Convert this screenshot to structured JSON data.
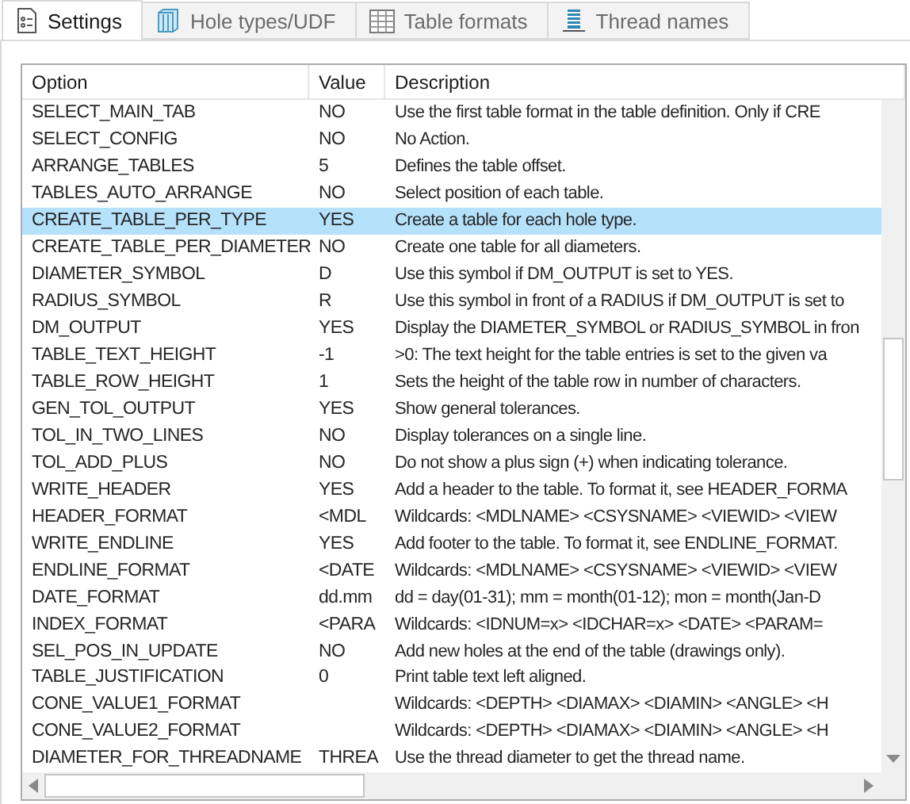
{
  "tabs": [
    {
      "label": "Settings",
      "selected": true
    },
    {
      "label": "Hole types/UDF",
      "selected": false
    },
    {
      "label": "Table formats",
      "selected": false
    },
    {
      "label": "Thread names",
      "selected": false
    }
  ],
  "table": {
    "columns": [
      "Option",
      "Value",
      "Description"
    ],
    "rows": [
      {
        "option": "SELECT_MAIN_TAB",
        "value": "NO",
        "description": "Use the first table format in the table definition. Only if CRE",
        "selected": false
      },
      {
        "option": "SELECT_CONFIG",
        "value": "NO",
        "description": "No Action.",
        "selected": false
      },
      {
        "option": "ARRANGE_TABLES",
        "value": "5",
        "description": "Defines the table offset.",
        "selected": false
      },
      {
        "option": "TABLES_AUTO_ARRANGE",
        "value": "NO",
        "description": "Select position of each table.",
        "selected": false
      },
      {
        "option": "CREATE_TABLE_PER_TYPE",
        "value": "YES",
        "description": "Create a table for each hole type.",
        "selected": true
      },
      {
        "option": "CREATE_TABLE_PER_DIAMETER",
        "value": "NO",
        "description": "Create one table for all diameters.",
        "selected": false
      },
      {
        "option": "DIAMETER_SYMBOL",
        "value": "D",
        "description": "Use this symbol if DM_OUTPUT is set to YES.",
        "selected": false
      },
      {
        "option": "RADIUS_SYMBOL",
        "value": "R",
        "description": "Use this symbol in front of a RADIUS if DM_OUTPUT is set to",
        "selected": false
      },
      {
        "option": "DM_OUTPUT",
        "value": "YES",
        "description": "Display the DIAMETER_SYMBOL or RADIUS_SYMBOL in fron",
        "selected": false
      },
      {
        "option": "TABLE_TEXT_HEIGHT",
        "value": "-1",
        "description": ">0: The text height for the table entries is set to the given va",
        "selected": false
      },
      {
        "option": "TABLE_ROW_HEIGHT",
        "value": "1",
        "description": "Sets the height of the table row in number of characters.",
        "selected": false
      },
      {
        "option": "GEN_TOL_OUTPUT",
        "value": "YES",
        "description": "Show general tolerances.",
        "selected": false
      },
      {
        "option": "TOL_IN_TWO_LINES",
        "value": "NO",
        "description": "Display tolerances on a single line.",
        "selected": false
      },
      {
        "option": "TOL_ADD_PLUS",
        "value": "NO",
        "description": "Do not show a plus sign (+) when indicating tolerance.",
        "selected": false
      },
      {
        "option": "WRITE_HEADER",
        "value": "YES",
        "description": "Add a header to the table. To format it, see HEADER_FORMA",
        "selected": false
      },
      {
        "option": "HEADER_FORMAT",
        "value": "<MDL",
        "description": "Wildcards: <MDLNAME> <CSYSNAME> <VIEWID> <VIEW",
        "selected": false
      },
      {
        "option": "WRITE_ENDLINE",
        "value": "YES",
        "description": "Add footer to the table. To format it, see ENDLINE_FORMAT.",
        "selected": false
      },
      {
        "option": "ENDLINE_FORMAT",
        "value": "<DATE",
        "description": "Wildcards: <MDLNAME> <CSYSNAME> <VIEWID> <VIEW",
        "selected": false
      },
      {
        "option": "DATE_FORMAT",
        "value": "dd.mm",
        "description": "dd = day(01-31); mm = month(01-12); mon = month(Jan-D",
        "selected": false
      },
      {
        "option": "INDEX_FORMAT",
        "value": "<PARA",
        "description": "Wildcards: <IDNUM=x> <IDCHAR=x> <DATE> <PARAM=",
        "selected": false
      },
      {
        "option": "SEL_POS_IN_UPDATE",
        "value": "NO",
        "description": "Add new holes at the end of the table (drawings only).",
        "selected": false
      },
      {
        "option": "TABLE_JUSTIFICATION",
        "value": "0",
        "description": "Print table text left aligned.",
        "selected": false
      },
      {
        "option": "CONE_VALUE1_FORMAT",
        "description": "Wildcards: <DEPTH> <DIAMAX> <DIAMIN> <ANGLE> <H",
        "selected": false
      },
      {
        "option": "CONE_VALUE2_FORMAT",
        "description": "Wildcards: <DEPTH> <DIAMAX> <DIAMIN> <ANGLE> <H",
        "selected": false
      },
      {
        "option": "DIAMETER_FOR_THREADNAME",
        "value": "THREA",
        "description": "Use the thread diameter to get the thread name.",
        "selected": false
      }
    ]
  }
}
